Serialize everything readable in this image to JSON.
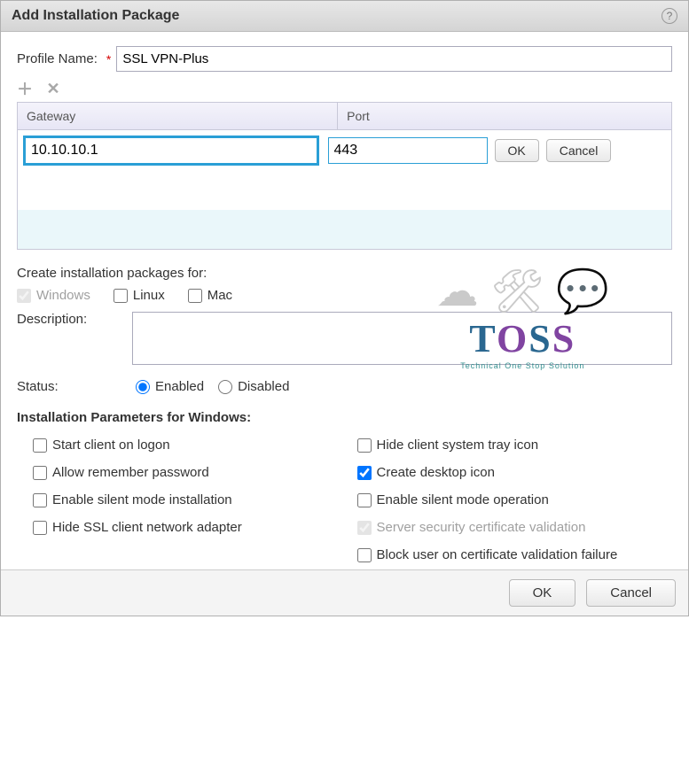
{
  "dialog": {
    "title": "Add Installation Package"
  },
  "profile": {
    "label": "Profile Name:",
    "value": "SSL VPN-Plus"
  },
  "grid": {
    "columns": {
      "gateway": "Gateway",
      "port": "Port"
    },
    "row": {
      "gateway": "10.10.10.1",
      "port": "443"
    },
    "ok": "OK",
    "cancel": "Cancel"
  },
  "packages": {
    "label": "Create installation packages for:",
    "windows": {
      "label": "Windows",
      "checked": true,
      "disabled": true
    },
    "linux": {
      "label": "Linux",
      "checked": false
    },
    "mac": {
      "label": "Mac",
      "checked": false
    }
  },
  "description": {
    "label": "Description:",
    "value": ""
  },
  "status": {
    "label": "Status:",
    "enabled": "Enabled",
    "disabled": "Disabled",
    "value": "enabled"
  },
  "params": {
    "heading": "Installation Parameters for Windows:",
    "start_on_logon": {
      "label": "Start client on logon",
      "checked": false
    },
    "hide_tray": {
      "label": "Hide client system tray icon",
      "checked": false
    },
    "remember_password": {
      "label": "Allow remember password",
      "checked": false
    },
    "create_desktop_icon": {
      "label": "Create desktop icon",
      "checked": true
    },
    "silent_install": {
      "label": "Enable silent mode installation",
      "checked": false
    },
    "silent_operation": {
      "label": "Enable silent mode operation",
      "checked": false
    },
    "hide_adapter": {
      "label": "Hide SSL client network adapter",
      "checked": false
    },
    "server_cert": {
      "label": "Server security certificate validation",
      "checked": true,
      "disabled": true
    },
    "block_on_cert_fail": {
      "label": "Block user on certificate validation failure",
      "checked": false
    }
  },
  "footer": {
    "ok": "OK",
    "cancel": "Cancel"
  },
  "watermark": {
    "brand": "TOSS",
    "tagline": "Technical One Stop Solution"
  }
}
